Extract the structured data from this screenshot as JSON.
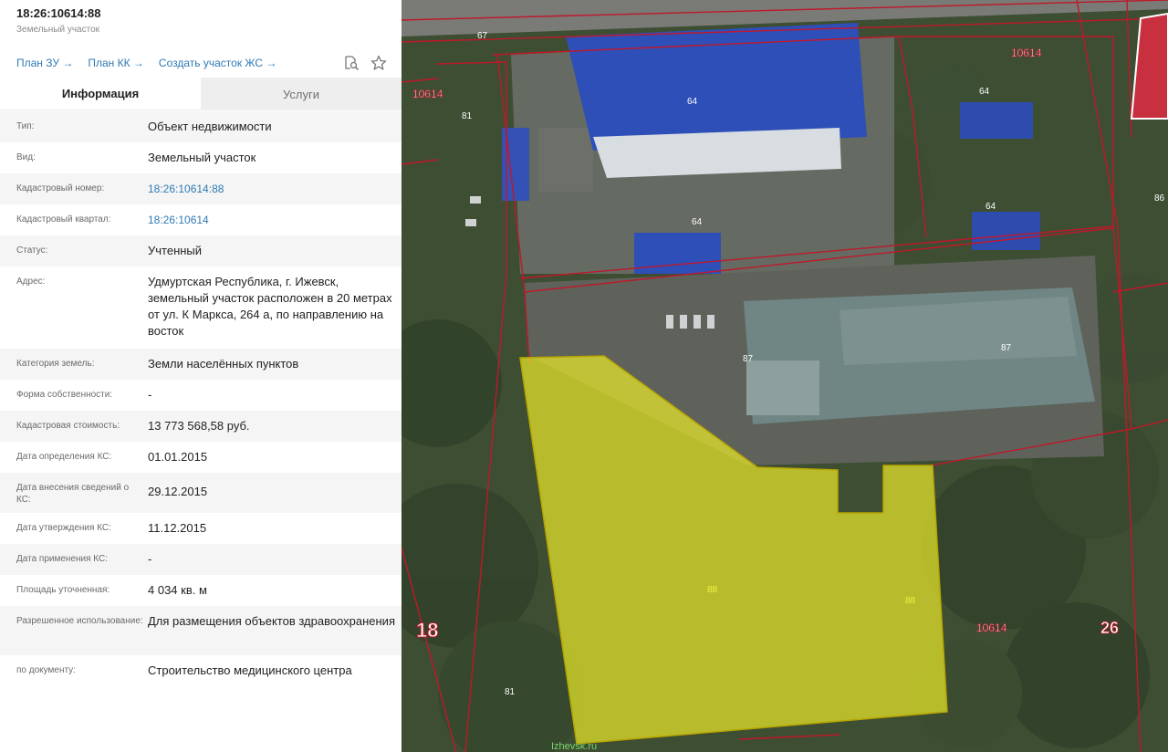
{
  "header": {
    "title": "18:26:10614:88",
    "subtitle": "Земельный участок",
    "links": [
      "План ЗУ →",
      "План КК →",
      "Создать участок ЖС →"
    ]
  },
  "icons": [
    "search-document-icon",
    "star-icon"
  ],
  "tabs": {
    "info": "Информация",
    "services": "Услуги"
  },
  "fields": [
    {
      "label": "Тип:",
      "value": "Объект недвижимости"
    },
    {
      "label": "Вид:",
      "value": "Земельный участок"
    },
    {
      "label": "Кадастровый номер:",
      "value": "18:26:10614:88"
    },
    {
      "label": "Кадастровый квартал:",
      "value": "18:26:10614"
    },
    {
      "label": "Статус:",
      "value": "Учтенный"
    },
    {
      "label": "Адрес:",
      "value": "Удмуртская Республика, г. Ижевск, земельный участок расположен в 20 метрах от ул. К Маркса, 264 а, по направлению на восток"
    },
    {
      "label": "Категория земель:",
      "value": "Земли населённых пунктов"
    },
    {
      "label": "Форма собственности:",
      "value": "-"
    },
    {
      "label": "Кадастровая стоимость:",
      "value": "13 773 568,58 руб."
    },
    {
      "label": "Дата определения КС:",
      "value": "01.01.2015"
    },
    {
      "label": "Дата внесения сведений о КС:",
      "value": "29.12.2015"
    },
    {
      "label": "Дата утверждения КС:",
      "value": "11.12.2015"
    },
    {
      "label": "Дата применения КС:",
      "value": "-"
    },
    {
      "label": "Площадь уточненная:",
      "value": "4 034 кв. м"
    },
    {
      "label": "Разрешенное использование:",
      "value": "Для размещения объектов здравоохранения"
    },
    {
      "label": "по документу:",
      "value": "Строительство медицинского центра"
    }
  ],
  "map": {
    "labels": {
      "l67": "67",
      "l10614a": "10614",
      "l10614b": "10614",
      "l10614c": "10614",
      "l81a": "81",
      "l81b": "81",
      "l64a": "64",
      "l64b": "64",
      "l64c": "64",
      "l64d": "64",
      "l86": "86",
      "l87a": "87",
      "l87b": "87",
      "l88a": "88",
      "l88b": "88",
      "l18": "18",
      "l26": "26",
      "watermark": "Izhevsk.ru"
    },
    "colors": {
      "boundary": "#c0182a",
      "parcel_fill": "#e8e82a",
      "roof": "#2f4fb8"
    }
  }
}
